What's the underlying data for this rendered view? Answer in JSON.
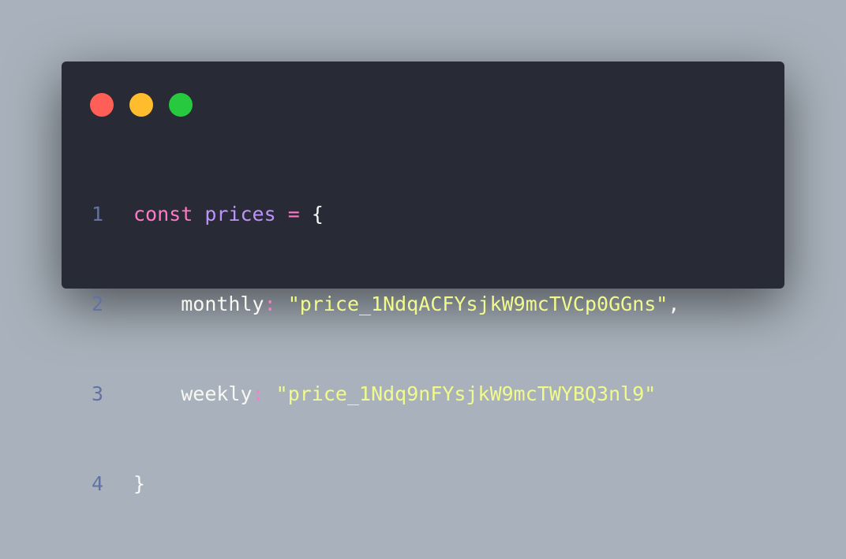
{
  "window_controls": {
    "close_color": "#ff5f56",
    "minimize_color": "#ffbd2e",
    "maximize_color": "#27c93f"
  },
  "code": {
    "lines": [
      {
        "number": "1",
        "keyword": "const",
        "variable": "prices",
        "operator": "=",
        "brace_open": "{"
      },
      {
        "number": "2",
        "property": "monthly",
        "colon": ":",
        "value": "\"price_1NdqACFYsjkW9mcTVCp0GGns\"",
        "comma": ","
      },
      {
        "number": "3",
        "property": "weekly",
        "colon": ":",
        "value": "\"price_1Ndq9nFYsjkW9mcTWYBQ3nl9\""
      },
      {
        "number": "4",
        "brace_close": "}"
      }
    ]
  }
}
